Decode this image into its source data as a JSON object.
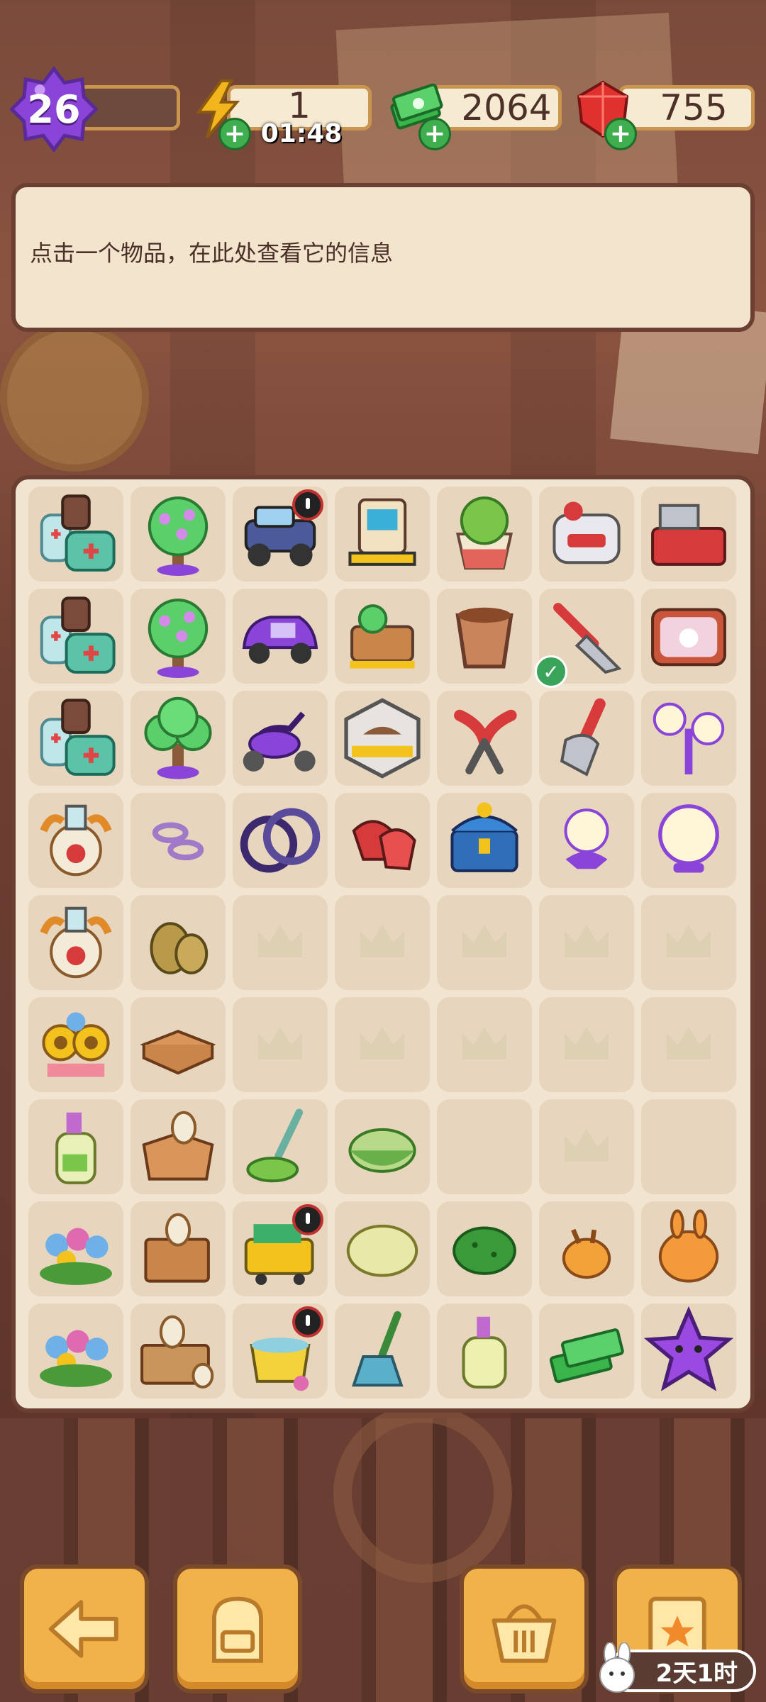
{
  "hud": {
    "level": "26",
    "energy": {
      "value": "1",
      "timer": "01:48"
    },
    "cash": {
      "value": "2064"
    },
    "gems": {
      "value": "755"
    },
    "colors": {
      "level": "#8a45d8",
      "energy": "#f3b51c",
      "cash": "#39b54a",
      "gems": "#e0312e"
    }
  },
  "info_panel": {
    "text": "点击一个物品，在此处查看它的信息"
  },
  "board": {
    "rows": 9,
    "cols": 7,
    "items": [
      [
        "first-aid-supplies",
        "flower-tree-blooming",
        "offroad-jeep",
        "pet-vending-stand",
        "potted-plant",
        "robot-gadget",
        "toolbox-open"
      ],
      [
        "first-aid-supplies",
        "flower-tree-blooming",
        "purple-car",
        "wooden-pet-bed",
        "clay-pot",
        "garden-rake",
        "retro-tv-bunny"
      ],
      [
        "first-aid-supplies",
        "bonsai-tree",
        "purple-scooter",
        "pet-tag-sign",
        "pruning-shears",
        "garden-shovel",
        "street-lamp-double"
      ],
      [
        "dragon-vase",
        "pink-ribbons",
        "bike-wheels",
        "red-gloves",
        "treasure-chest",
        "crystal-lamp",
        "crystal-orb"
      ],
      [
        "dragon-vase",
        "burlap-sacks",
        "empty",
        "empty",
        "empty",
        "empty",
        "empty"
      ],
      [
        "sunflower-bouquet",
        "cardboard-flat",
        "empty",
        "empty",
        "empty",
        "empty",
        "empty"
      ],
      [
        "spray-bottle",
        "open-box-vases",
        "broom-green",
        "sponge-cake",
        "locked",
        "empty",
        "locked"
      ],
      [
        "flower-basket",
        "crate-vases",
        "cleaning-cart",
        "soap-bar",
        "green-sponge",
        "bunny-lantern-small",
        "bunny-lantern"
      ],
      [
        "flower-basket",
        "crate-pottery",
        "mop-bucket",
        "bottle-brush",
        "soap-dispenser",
        "cash-stack",
        "purple-star"
      ]
    ]
  },
  "nav": {
    "back_icon": "arrow-left-icon",
    "backpack_icon": "backpack-icon",
    "basket_icon": "basket-icon",
    "tasks_icon": "clipboard-star-icon",
    "event_timer": "2天1时"
  }
}
